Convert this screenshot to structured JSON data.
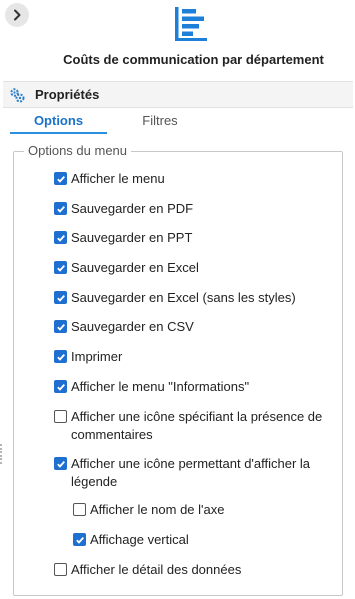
{
  "panel": {
    "collapse_icon": "chevron-right-icon",
    "chart_icon": "horizontal-bar-chart-icon",
    "title": "Coûts de communication par département"
  },
  "properties": {
    "icon": "gears-icon",
    "label": "Propriétés"
  },
  "tabs": [
    {
      "label": "Options",
      "active": true
    },
    {
      "label": "Filtres",
      "active": false
    }
  ],
  "menu_options": {
    "legend": "Options du menu",
    "items": [
      {
        "label": "Afficher le menu",
        "checked": true
      },
      {
        "label": "Sauvegarder en PDF",
        "checked": true
      },
      {
        "label": "Sauvegarder en PPT",
        "checked": true
      },
      {
        "label": "Sauvegarder en Excel",
        "checked": true
      },
      {
        "label": "Sauvegarder en Excel (sans les styles)",
        "checked": true
      },
      {
        "label": "Sauvegarder en CSV",
        "checked": true
      },
      {
        "label": "Imprimer",
        "checked": true
      },
      {
        "label": "Afficher le menu \"Informations\"",
        "checked": true
      },
      {
        "label": "Afficher une icône spécifiant la présence de commentaires",
        "checked": false
      },
      {
        "label": "Afficher une icône permettant d'afficher la légende",
        "checked": true
      },
      {
        "label": "Afficher le nom de l'axe",
        "checked": false
      },
      {
        "label": "Affichage vertical",
        "checked": true
      },
      {
        "label": "Afficher le détail des données",
        "checked": false
      }
    ]
  },
  "colors": {
    "accent": "#1e6fd0",
    "tab_active": "#1a73c8",
    "chart_icon": "#1e7fd8"
  }
}
